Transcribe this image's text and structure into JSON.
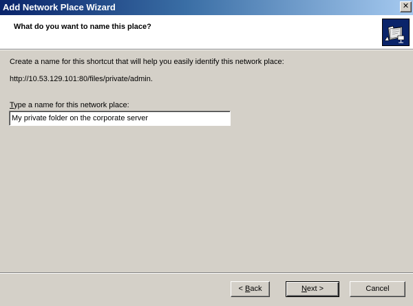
{
  "window": {
    "title": "Add Network Place Wizard",
    "close_glyph": "✕"
  },
  "header": {
    "title": "What do you want to name this place?",
    "icon": "network-folder-wizard-icon"
  },
  "content": {
    "description": "Create a name for this shortcut that will help you easily identify this network place:",
    "path": "http://10.53.129.101:80/files/private/admin.",
    "field_label_accel": "T",
    "field_label_rest": "ype a name for this network place:",
    "field_value": "My private folder on the corporate server"
  },
  "buttons": {
    "back_arrow": "< ",
    "back_accel": "B",
    "back_rest": "ack",
    "next_accel": "N",
    "next_rest": "ext",
    "next_arrow": " >",
    "cancel": "Cancel"
  },
  "colors": {
    "titlebar_start": "#0a246a",
    "titlebar_end": "#a6caf0",
    "face": "#d4d0c8"
  }
}
